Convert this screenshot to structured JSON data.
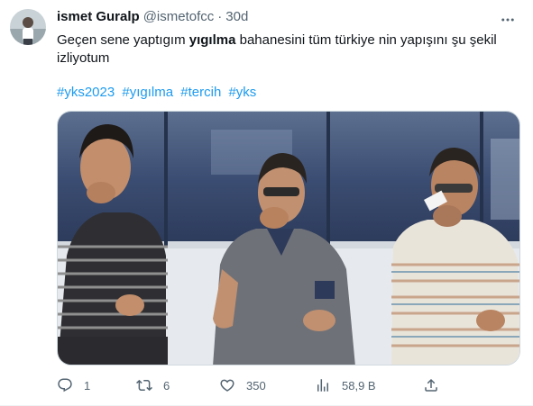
{
  "tweet": {
    "display_name": "ismet Guralp",
    "handle": "@ismetofcc",
    "separator": "·",
    "time": "30d",
    "text_before": "Geçen sene yaptıgım ",
    "text_bold": "yıgılma",
    "text_after": " bahanesini tüm türkiye nin yapışını şu şekil izliyotum",
    "hashtags": [
      "#yks2023",
      "#yıgılma",
      "#tercih",
      "#yks"
    ]
  },
  "actions": {
    "replies": "1",
    "retweets": "6",
    "likes": "350",
    "views": "58,9 B"
  },
  "icons": {
    "more": "more-dots-icon",
    "reply": "reply-icon",
    "retweet": "retweet-icon",
    "like": "heart-icon",
    "views": "views-chart-icon",
    "share": "share-icon"
  },
  "colors": {
    "link": "#1d9bf0",
    "secondary": "#536471",
    "text": "#0f1419"
  }
}
